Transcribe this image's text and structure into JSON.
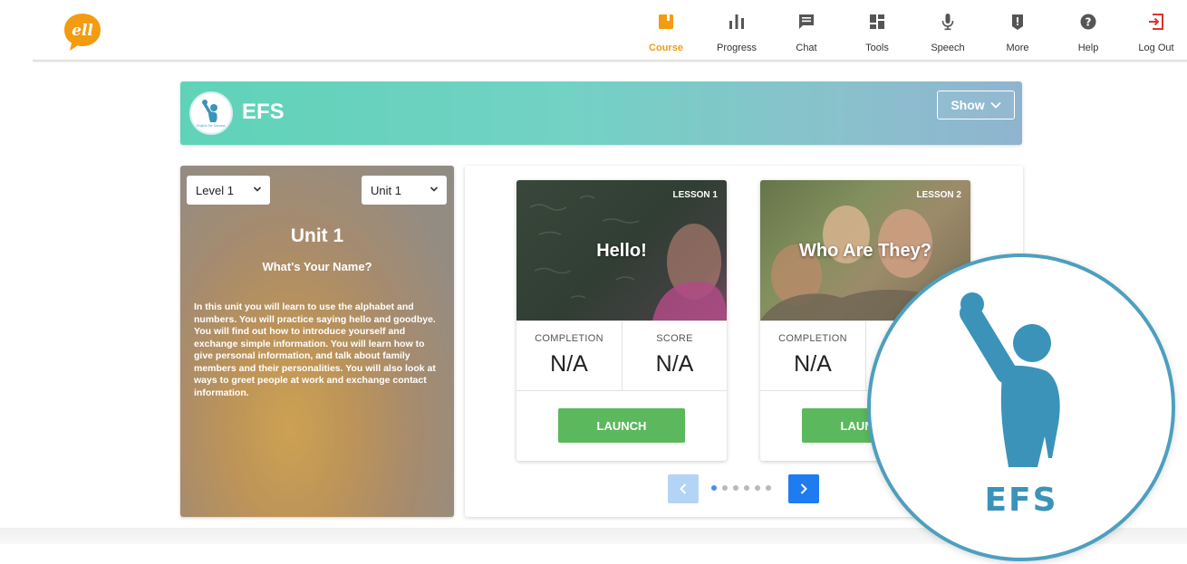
{
  "app": {
    "logo_text": "ell"
  },
  "nav": {
    "items": [
      {
        "label": "Course",
        "icon": "course-icon",
        "active": true
      },
      {
        "label": "Progress",
        "icon": "progress-icon"
      },
      {
        "label": "Chat",
        "icon": "chat-icon"
      },
      {
        "label": "Tools",
        "icon": "tools-icon"
      },
      {
        "label": "Speech",
        "icon": "microphone-icon"
      },
      {
        "label": "More",
        "icon": "more-icon"
      },
      {
        "label": "Help",
        "icon": "help-icon"
      },
      {
        "label": "Log Out",
        "icon": "logout-icon"
      }
    ],
    "active_color": "#f39c12",
    "logout_color": "#d9342b"
  },
  "banner": {
    "title": "EFS",
    "logo_caption": "English For Success",
    "show_label": "Show"
  },
  "unit": {
    "level_select": "Level 1",
    "unit_select": "Unit 1",
    "title": "Unit 1",
    "subtitle": "What's Your Name?",
    "description": "In this unit you will learn to use the alphabet and numbers. You will practice saying hello and goodbye. You will find out how to introduce yourself and exchange simple information. You will learn how to give personal information, and talk about family members and their personalities. You will also look at ways to greet people at work and exchange contact information."
  },
  "lessons": [
    {
      "number": "LESSON 1",
      "title": "Hello!",
      "completion_label": "COMPLETION",
      "completion": "N/A",
      "score_label": "SCORE",
      "score": "N/A",
      "launch_label": "LAUNCH"
    },
    {
      "number": "LESSON 2",
      "title": "Who Are They?",
      "completion_label": "COMPLETION",
      "completion": "N/A",
      "launch_label": "LAUNCH"
    }
  ],
  "pager": {
    "active_index": 0,
    "total_pages": 6
  },
  "badge": {
    "text": "EFS",
    "color": "#3b93ba"
  },
  "colors": {
    "launch": "#5cb85c",
    "pager_next": "#1f7cf0",
    "pager_prev": "#b3d4f5"
  }
}
